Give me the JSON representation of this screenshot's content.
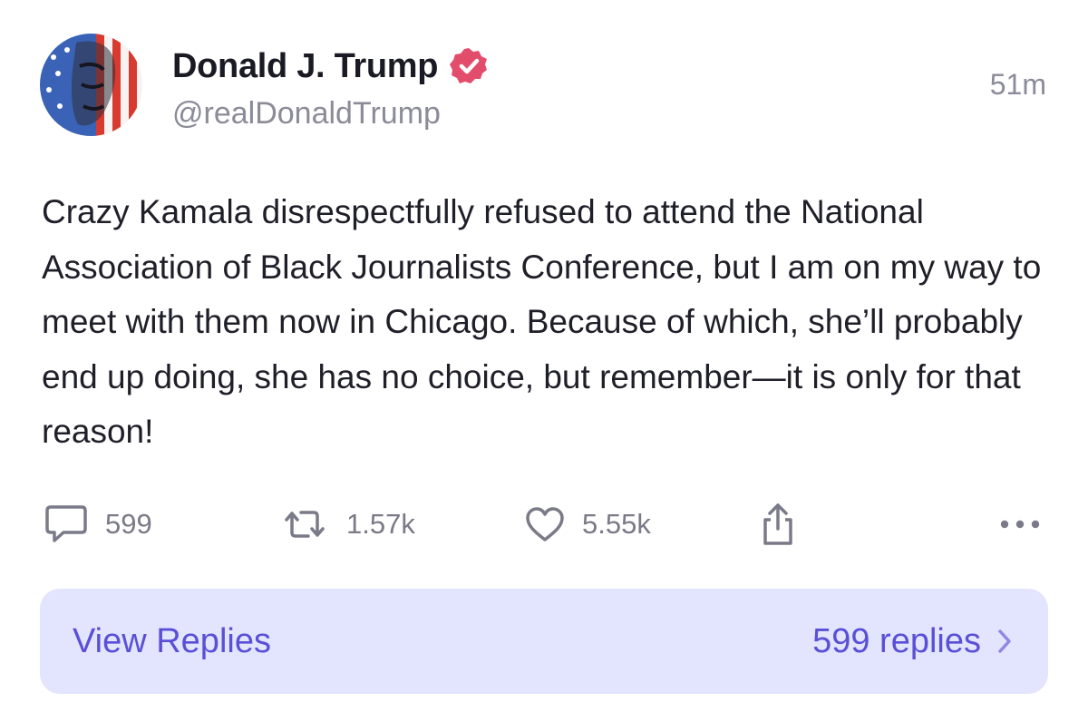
{
  "author": {
    "display_name": "Donald J. Trump",
    "handle": "@realDonaldTrump",
    "verified": true,
    "verified_badge_color": "#e34d6c"
  },
  "post": {
    "timestamp": "51m",
    "text": "Crazy Kamala disrespectfully refused to attend the National Association of Black Journalists Conference, but I am on my way to meet with them now in Chicago. Because of which, she’ll probably end up doing, she has no choice, but remember—it is only for that reason!"
  },
  "actions": {
    "replies": {
      "icon": "speech-bubble-icon",
      "count": "599"
    },
    "reposts": {
      "icon": "repost-icon",
      "count": "1.57k"
    },
    "likes": {
      "icon": "heart-icon",
      "count": "5.55k"
    },
    "share": {
      "icon": "share-icon"
    },
    "more": {
      "icon": "more-dots-icon"
    }
  },
  "replies_bar": {
    "label": "View Replies",
    "count_text": "599 replies",
    "background": "#e3e5ff",
    "text_color": "#5b4fd6"
  }
}
